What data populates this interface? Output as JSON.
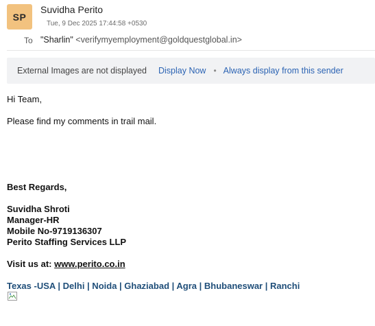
{
  "header": {
    "avatar_initials": "SP",
    "avatar_color": "#f2c27f",
    "sender_name": "Suvidha Perito",
    "sent_date": "Tue, 9 Dec 2025 17:44:58 +0530",
    "to_label": "To",
    "to_name": "\"Sharlin\"",
    "to_address": "<verifymyemployment@goldquestglobal.in>"
  },
  "banner": {
    "message": "External Images are not displayed",
    "display_now": "Display Now",
    "separator": "•",
    "always_display": "Always display from this sender",
    "link_color": "#2b63b3"
  },
  "body": {
    "greeting": "Hi Team,",
    "line1": "Please find my comments in trail mail."
  },
  "signature": {
    "regards": "Best Regards,",
    "name": "Suvidha Shroti",
    "role": "Manager-HR",
    "mobile": "Mobile No-9719136307",
    "company": "Perito Staffing Services LLP",
    "visit_label": "Visit us at: ",
    "website": "www.perito.co.in",
    "locations": "Texas -USA | Delhi | Noida | Ghaziabad | Agra | Bhubaneswar | Ranchi",
    "locations_color": "#1f4e79",
    "image_icon": "broken-image-icon"
  }
}
